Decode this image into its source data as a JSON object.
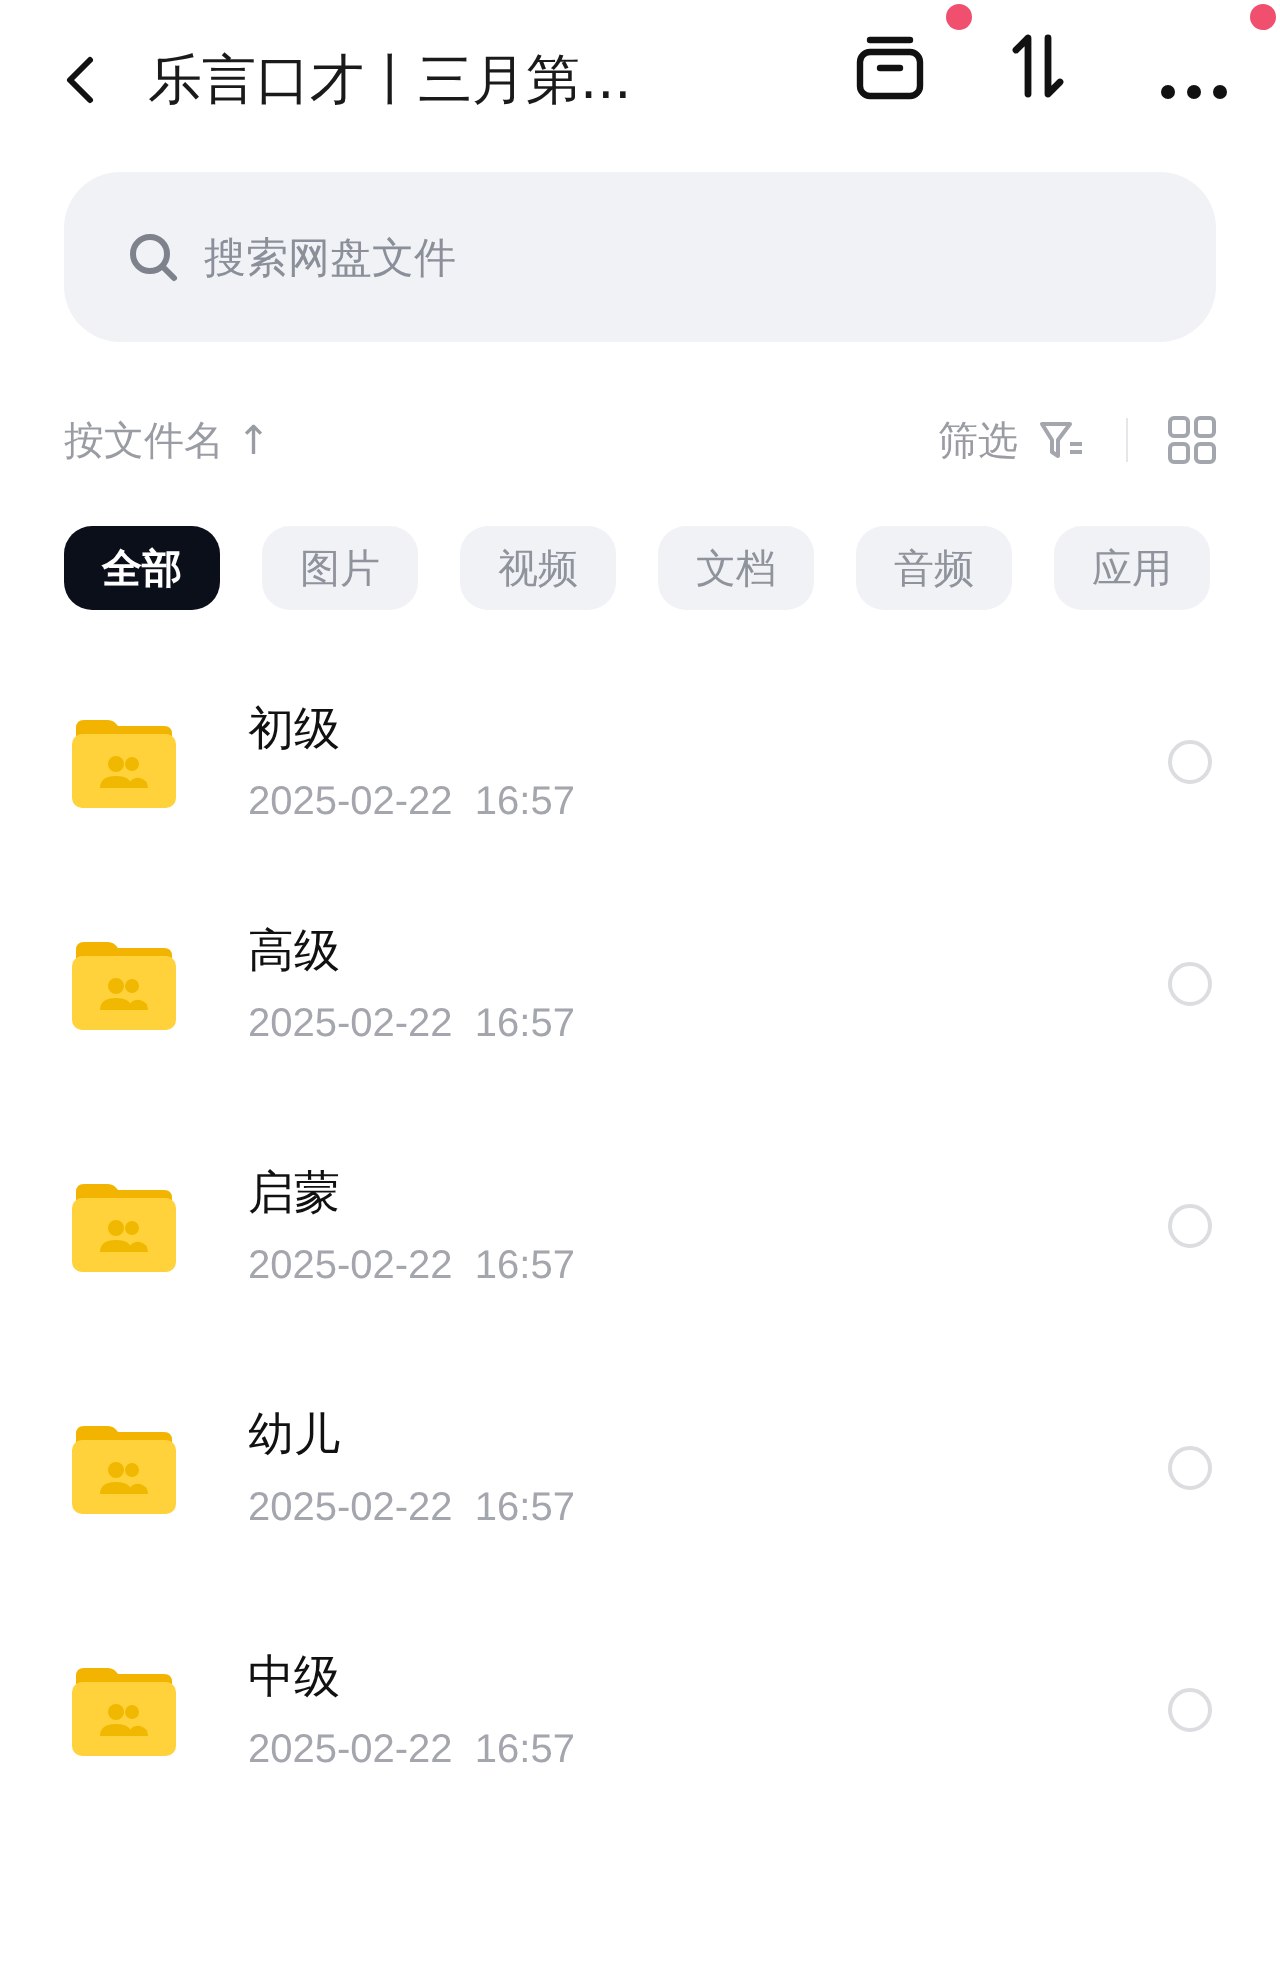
{
  "header": {
    "title": "乐言口才丨三月第...",
    "actions": [
      {
        "kind": "archive",
        "dot": true
      },
      {
        "kind": "sort",
        "dot": false
      },
      {
        "kind": "more",
        "dot": true
      }
    ]
  },
  "search": {
    "placeholder": "搜索网盘文件"
  },
  "sort_bar": {
    "sort_label": "按文件名 ↑",
    "filter_label": "筛选"
  },
  "chips": [
    {
      "label": "全部",
      "selected": true
    },
    {
      "label": "图片",
      "selected": false
    },
    {
      "label": "视频",
      "selected": false
    },
    {
      "label": "文档",
      "selected": false
    },
    {
      "label": "音频",
      "selected": false
    },
    {
      "label": "应用",
      "selected": false
    }
  ],
  "files": [
    {
      "name": "初级",
      "date": "2025-02-22  16:57",
      "checked": false
    },
    {
      "name": "高级",
      "date": "2025-02-22  16:57",
      "checked": false
    },
    {
      "name": "启蒙",
      "date": "2025-02-22  16:57",
      "checked": false
    },
    {
      "name": "幼儿",
      "date": "2025-02-22  16:57",
      "checked": false
    },
    {
      "name": "中级",
      "date": "2025-02-22  16:57",
      "checked": false
    }
  ]
}
